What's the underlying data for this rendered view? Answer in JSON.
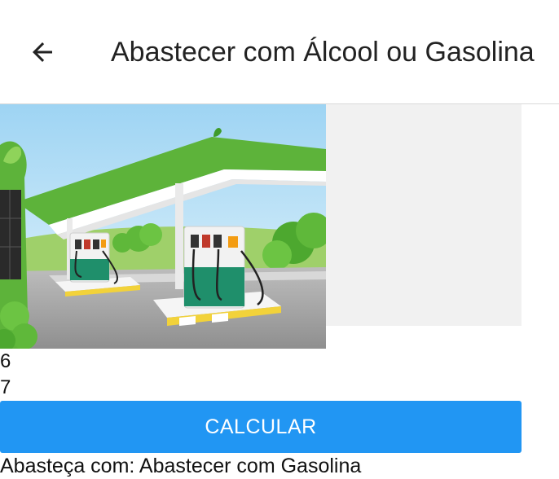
{
  "header": {
    "back_icon": "arrow-left-icon",
    "title": "Abastecer com Álcool ou Gasolina"
  },
  "main": {
    "image_description_icon": "gas-station-illustration",
    "alcohol_value": "6",
    "gasoline_value": "7",
    "calculate_label": "CALCULAR",
    "result_text": "Abasteça com: Abastecer com Gasolina"
  },
  "colors": {
    "accent": "#2196f3",
    "canopy_green": "#5db33a",
    "pump_green": "#1f8f6b"
  }
}
